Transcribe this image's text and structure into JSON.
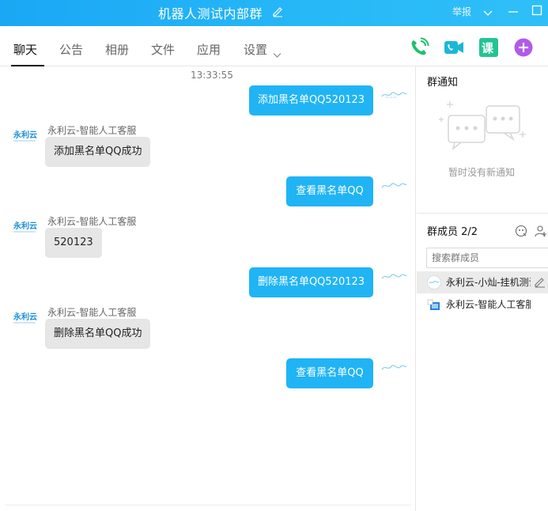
{
  "window": {
    "title": "机器人测试内部群",
    "report_label": "举报"
  },
  "tabs": [
    {
      "label": "聊天",
      "active": true
    },
    {
      "label": "公告"
    },
    {
      "label": "相册"
    },
    {
      "label": "文件"
    },
    {
      "label": "应用"
    },
    {
      "label": "设置"
    }
  ],
  "toolbar": {
    "icons": [
      "phone-icon",
      "video-call-icon",
      "course-icon",
      "plus-icon"
    ],
    "course_label": "课"
  },
  "chat": {
    "timestamp": "13:33:55",
    "bot_logo_text": "永利云",
    "messages": [
      {
        "direction": "out",
        "text": "添加黑名单QQ520123"
      },
      {
        "direction": "in",
        "sender": "永利云-智能人工客服",
        "text": "添加黑名单QQ成功"
      },
      {
        "direction": "out",
        "text": "查看黑名单QQ"
      },
      {
        "direction": "in",
        "sender": "永利云-智能人工客服",
        "text": "520123"
      },
      {
        "direction": "out",
        "text": "删除黑名单QQ520123"
      },
      {
        "direction": "in",
        "sender": "永利云-智能人工客服",
        "text": "删除黑名单QQ成功"
      },
      {
        "direction": "out",
        "text": "查看黑名单QQ"
      }
    ]
  },
  "notice": {
    "title": "群通知",
    "empty_text": "暂时没有新通知"
  },
  "members": {
    "title": "群成员 2/2",
    "search_placeholder": "搜索群成员",
    "list": [
      {
        "name": "永利云-小灿-挂机测试",
        "selected": true
      },
      {
        "name": "永利云-智能人工客服"
      }
    ]
  },
  "colors": {
    "titlebar": "#1aa7f5",
    "bubble_out": "#20b4f5",
    "bubble_in": "#e6e6e6",
    "phone_green": "#1fc16b",
    "video_teal": "#19b8d6",
    "course_green": "#22c493",
    "plus_purple": "#b25be8"
  }
}
